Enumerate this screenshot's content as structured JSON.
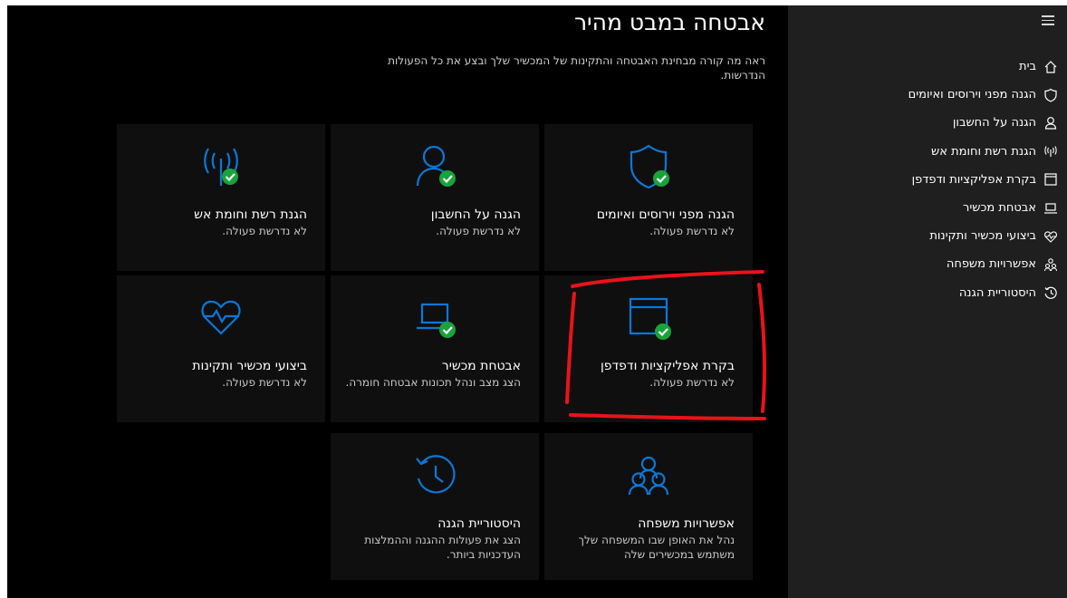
{
  "colors": {
    "accent": "#0a78d7",
    "check_green": "#18a43a",
    "sidebar_bg": "#1f1f1f",
    "main_bg": "#000000",
    "tile_bg": "#0f0f0f",
    "annotation": "#e8131b"
  },
  "header": {
    "title": "אבטחה במבט מהיר",
    "subtitle": "ראה מה קורה מבחינת האבטחה והתקינות של המכשיר שלך ובצע את כל הפעולות הנדרשות."
  },
  "sidebar": {
    "menu_icon": "hamburger-icon",
    "items": [
      {
        "label": "בית",
        "icon": "home-icon"
      },
      {
        "label": "הגנה מפני וירוסים ואיומים",
        "icon": "shield-icon"
      },
      {
        "label": "הגנה על החשבון",
        "icon": "person-icon"
      },
      {
        "label": "הגנת רשת וחומת אש",
        "icon": "antenna-icon"
      },
      {
        "label": "בקרת אפליקציות ודפדפן",
        "icon": "browser-icon"
      },
      {
        "label": "אבטחת מכשיר",
        "icon": "laptop-icon"
      },
      {
        "label": "ביצועי מכשיר ותקינות",
        "icon": "heart-icon"
      },
      {
        "label": "אפשרויות משפחה",
        "icon": "family-icon"
      },
      {
        "label": "היסטוריית הגנה",
        "icon": "history-icon"
      }
    ]
  },
  "tiles": [
    {
      "title": "הגנה מפני וירוסים ואיומים",
      "desc": "לא נדרשת פעולה.",
      "icon": "shield-check-icon"
    },
    {
      "title": "הגנה על החשבון",
      "desc": "לא נדרשת פעולה.",
      "icon": "person-check-icon"
    },
    {
      "title": "הגנת רשת וחומת אש",
      "desc": "לא נדרשת פעולה.",
      "icon": "antenna-check-icon"
    },
    {
      "title": "בקרת אפליקציות ודפדפן",
      "desc": "לא נדרשת פעולה.",
      "icon": "browser-check-icon"
    },
    {
      "title": "אבטחת מכשיר",
      "desc": "הצג מצב ונהל תכונות אבטחה חומרה.",
      "icon": "laptop-check-icon"
    },
    {
      "title": "ביצועי מכשיר ותקינות",
      "desc": "לא נדרשת פעולה.",
      "icon": "heart-icon"
    },
    {
      "title": "אפשרויות משפחה",
      "desc": "נהל את האופן שבו המשפחה שלך משתמש במכשירים שלה",
      "icon": "family-icon"
    },
    {
      "title": "היסטוריית הגנה",
      "desc": "הצג את פעולות ההגנה וההמלצות העדכניות ביותר.",
      "icon": "history-icon"
    }
  ]
}
